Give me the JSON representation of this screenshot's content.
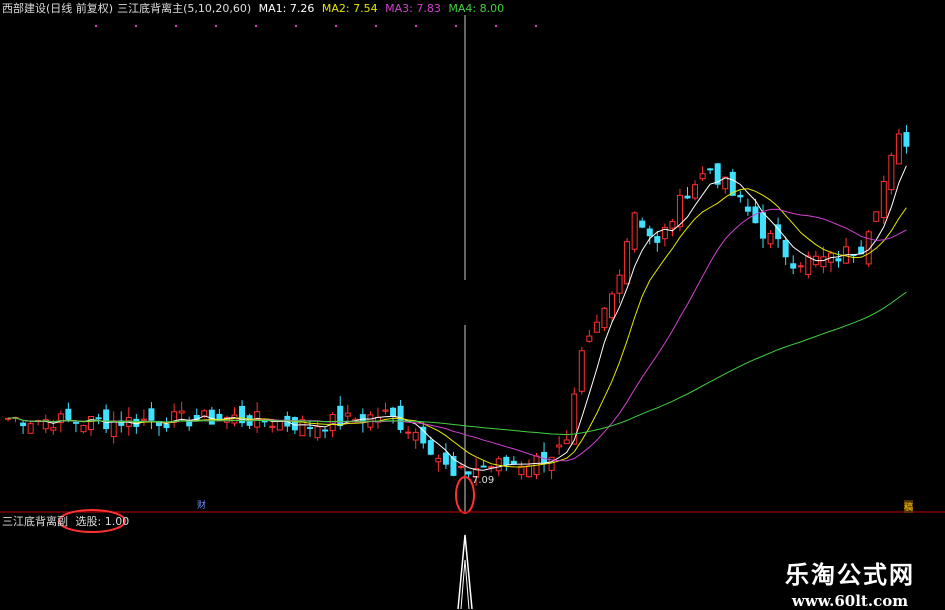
{
  "header": {
    "title": "西部建设(日线 前复权)",
    "indicator": "三江底背离主",
    "params": "(5,10,20,60)",
    "ma": [
      {
        "label": "MA1:",
        "value": "7.26",
        "color": "#ffffff"
      },
      {
        "label": "MA2:",
        "value": "7.54",
        "color": "#e6e600"
      },
      {
        "label": "MA3:",
        "value": "7.83",
        "color": "#d040d0"
      },
      {
        "label": "MA4:",
        "value": "8.00",
        "color": "#40d040"
      }
    ]
  },
  "chart": {
    "low_price_label": "7.09",
    "fin_mark_1": "财",
    "fin_mark_2": "稿",
    "colors": {
      "up": "#ff3030",
      "down": "#40e0ff",
      "ma1": "#ffffff",
      "ma2": "#e6e600",
      "ma3": "#d040d0",
      "ma4": "#40d040",
      "divider": "#c00000",
      "cursor": "#cccccc",
      "highlight": "#ff3030"
    }
  },
  "sub_panel": {
    "title": "三江底背离副",
    "label": "选股:",
    "value": "1.00"
  },
  "watermark": {
    "name": "乐淘公式网",
    "url": "www.60lt.com"
  },
  "chart_data": {
    "type": "candlestick",
    "series": [
      {
        "name": "MA1",
        "color": "#ffffff"
      },
      {
        "name": "MA2",
        "color": "#e6e600"
      },
      {
        "name": "MA3",
        "color": "#d040d0"
      },
      {
        "name": "MA4",
        "color": "#40d040"
      }
    ],
    "low_annotation": 7.09,
    "signal_value": 1.0
  }
}
